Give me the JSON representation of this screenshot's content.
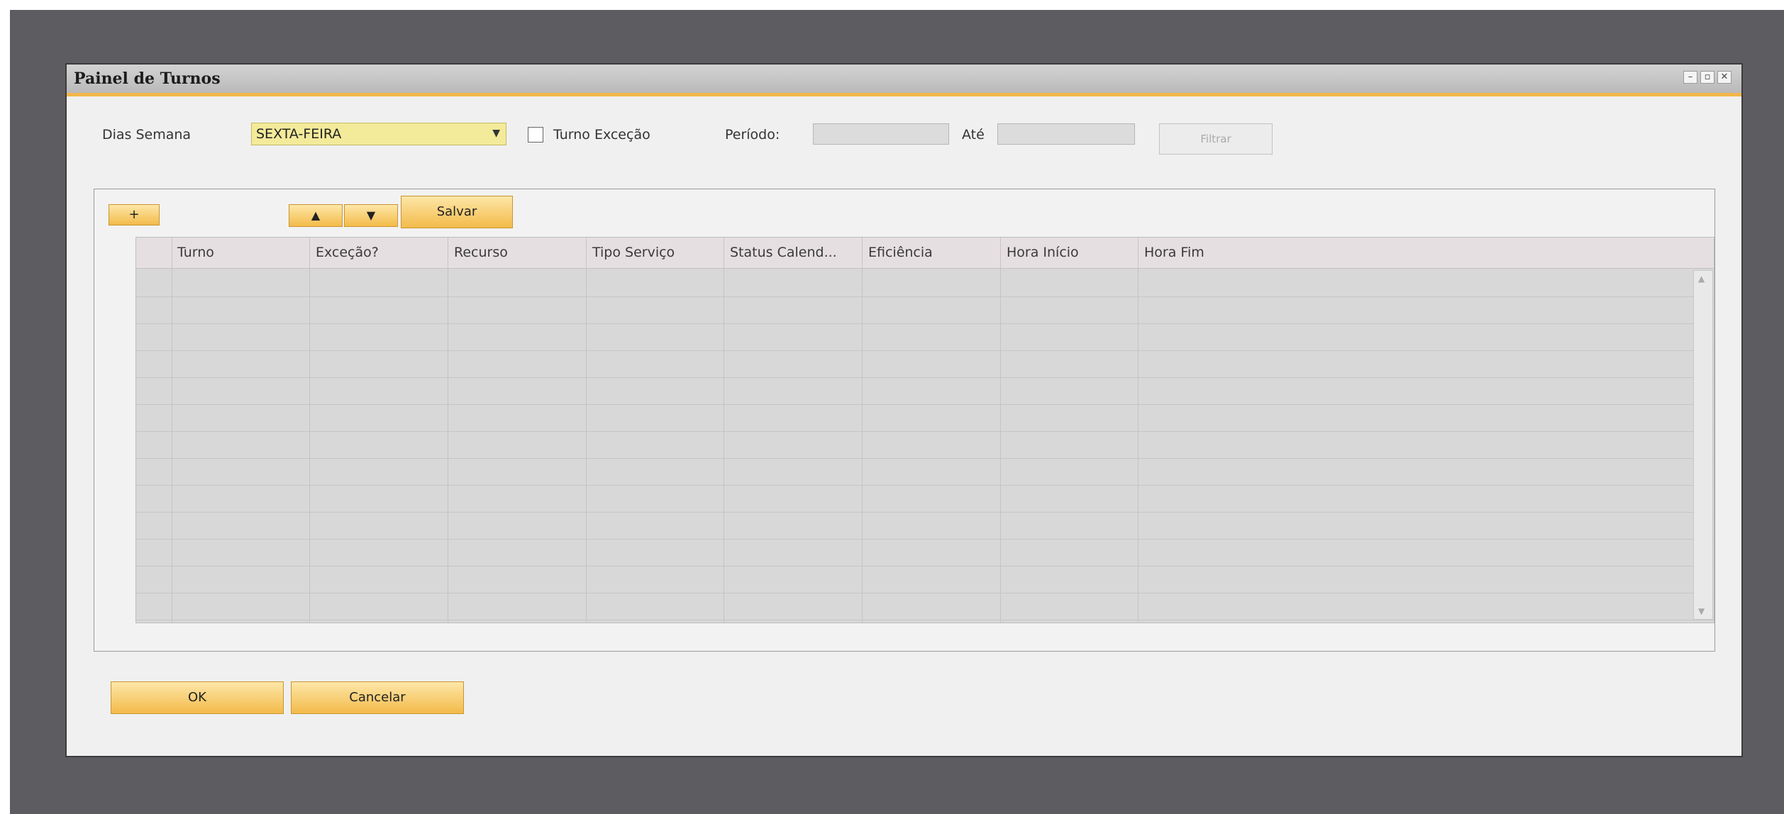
{
  "window": {
    "title": "Painel de Turnos",
    "controls": [
      "minimize-icon",
      "maximize-icon",
      "close-icon"
    ]
  },
  "filters": {
    "dia_semana_label": "Dias Semana",
    "dia_semana_value": "SEXTA-FEIRA",
    "turno_excecao_label": "Turno Exceção",
    "turno_excecao_checked": false,
    "periodo_label": "Período:",
    "periodo_de": "",
    "ate_label": "Até",
    "periodo_ate": "",
    "filtrar_label": "Filtrar"
  },
  "toolbar": {
    "add_label": "+",
    "move_up_label": "▲",
    "move_down_label": "▼",
    "salvar_label": "Salvar"
  },
  "grid": {
    "columns": [
      "Turno",
      "Exceção?",
      "Recurso",
      "Tipo Serviço",
      "Status Calend...",
      "Eficiência",
      "Hora Início",
      "Hora Fim"
    ],
    "rows": []
  },
  "footer": {
    "ok_label": "OK",
    "cancelar_label": "Cancelar"
  },
  "colors": {
    "accent": "#f2b64a",
    "select_bg": "#f3ea9a",
    "grid_bg": "#d8d8d8"
  }
}
